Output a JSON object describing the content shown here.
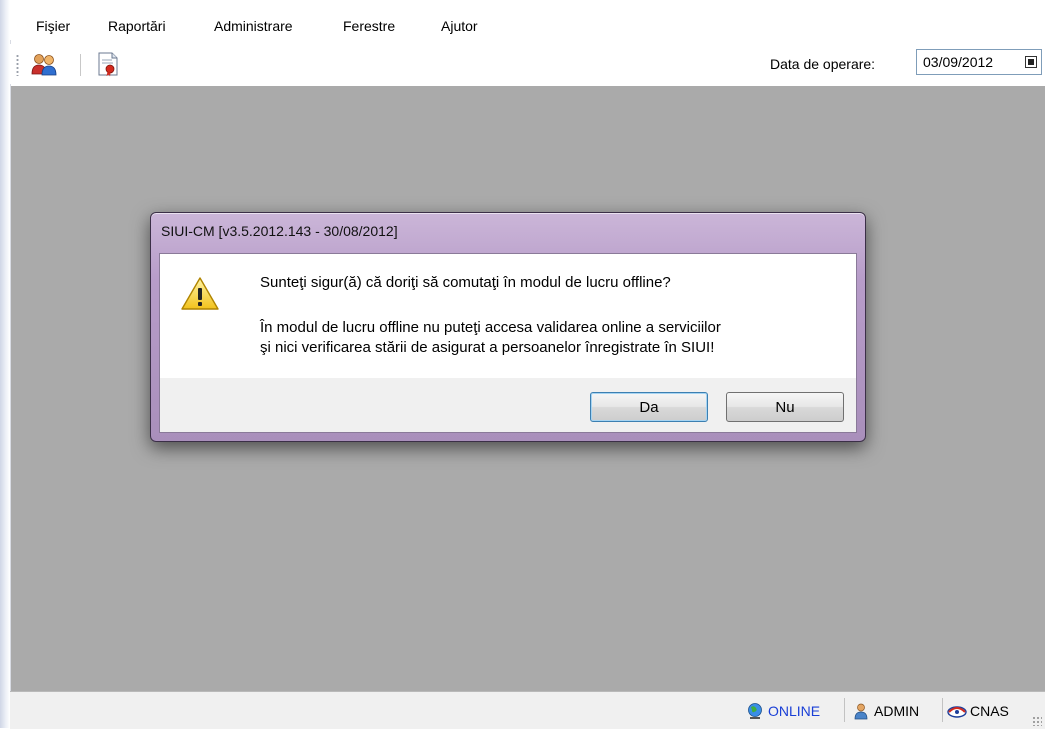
{
  "menu": {
    "items": [
      "Fişier",
      "Raportări",
      "Administrare",
      "Ferestre",
      "Ajutor"
    ]
  },
  "toolbar": {
    "icons": [
      "users-icon",
      "certificate-document-icon"
    ],
    "operation_date_label": "Data de operare:",
    "operation_date_value": "03/09/2012"
  },
  "dialog": {
    "title": "SIUI-CM [v3.5.2012.143 - 30/08/2012]",
    "icon": "warning-icon",
    "question": "Sunteţi sigur(ă) că doriţi să comutaţi în modul de lucru offline?",
    "info_line1": "În modul de lucru offline nu puteţi accesa validarea online a serviciilor",
    "info_line2": "şi nici verificarea stării de asigurat a persoanelor înregistrate în SIUI!",
    "yes_label": "Da",
    "no_label": "Nu"
  },
  "status": {
    "connection": "ONLINE",
    "connection_color": "#1a3fd6",
    "user": "ADMIN",
    "organization": "CNAS"
  }
}
